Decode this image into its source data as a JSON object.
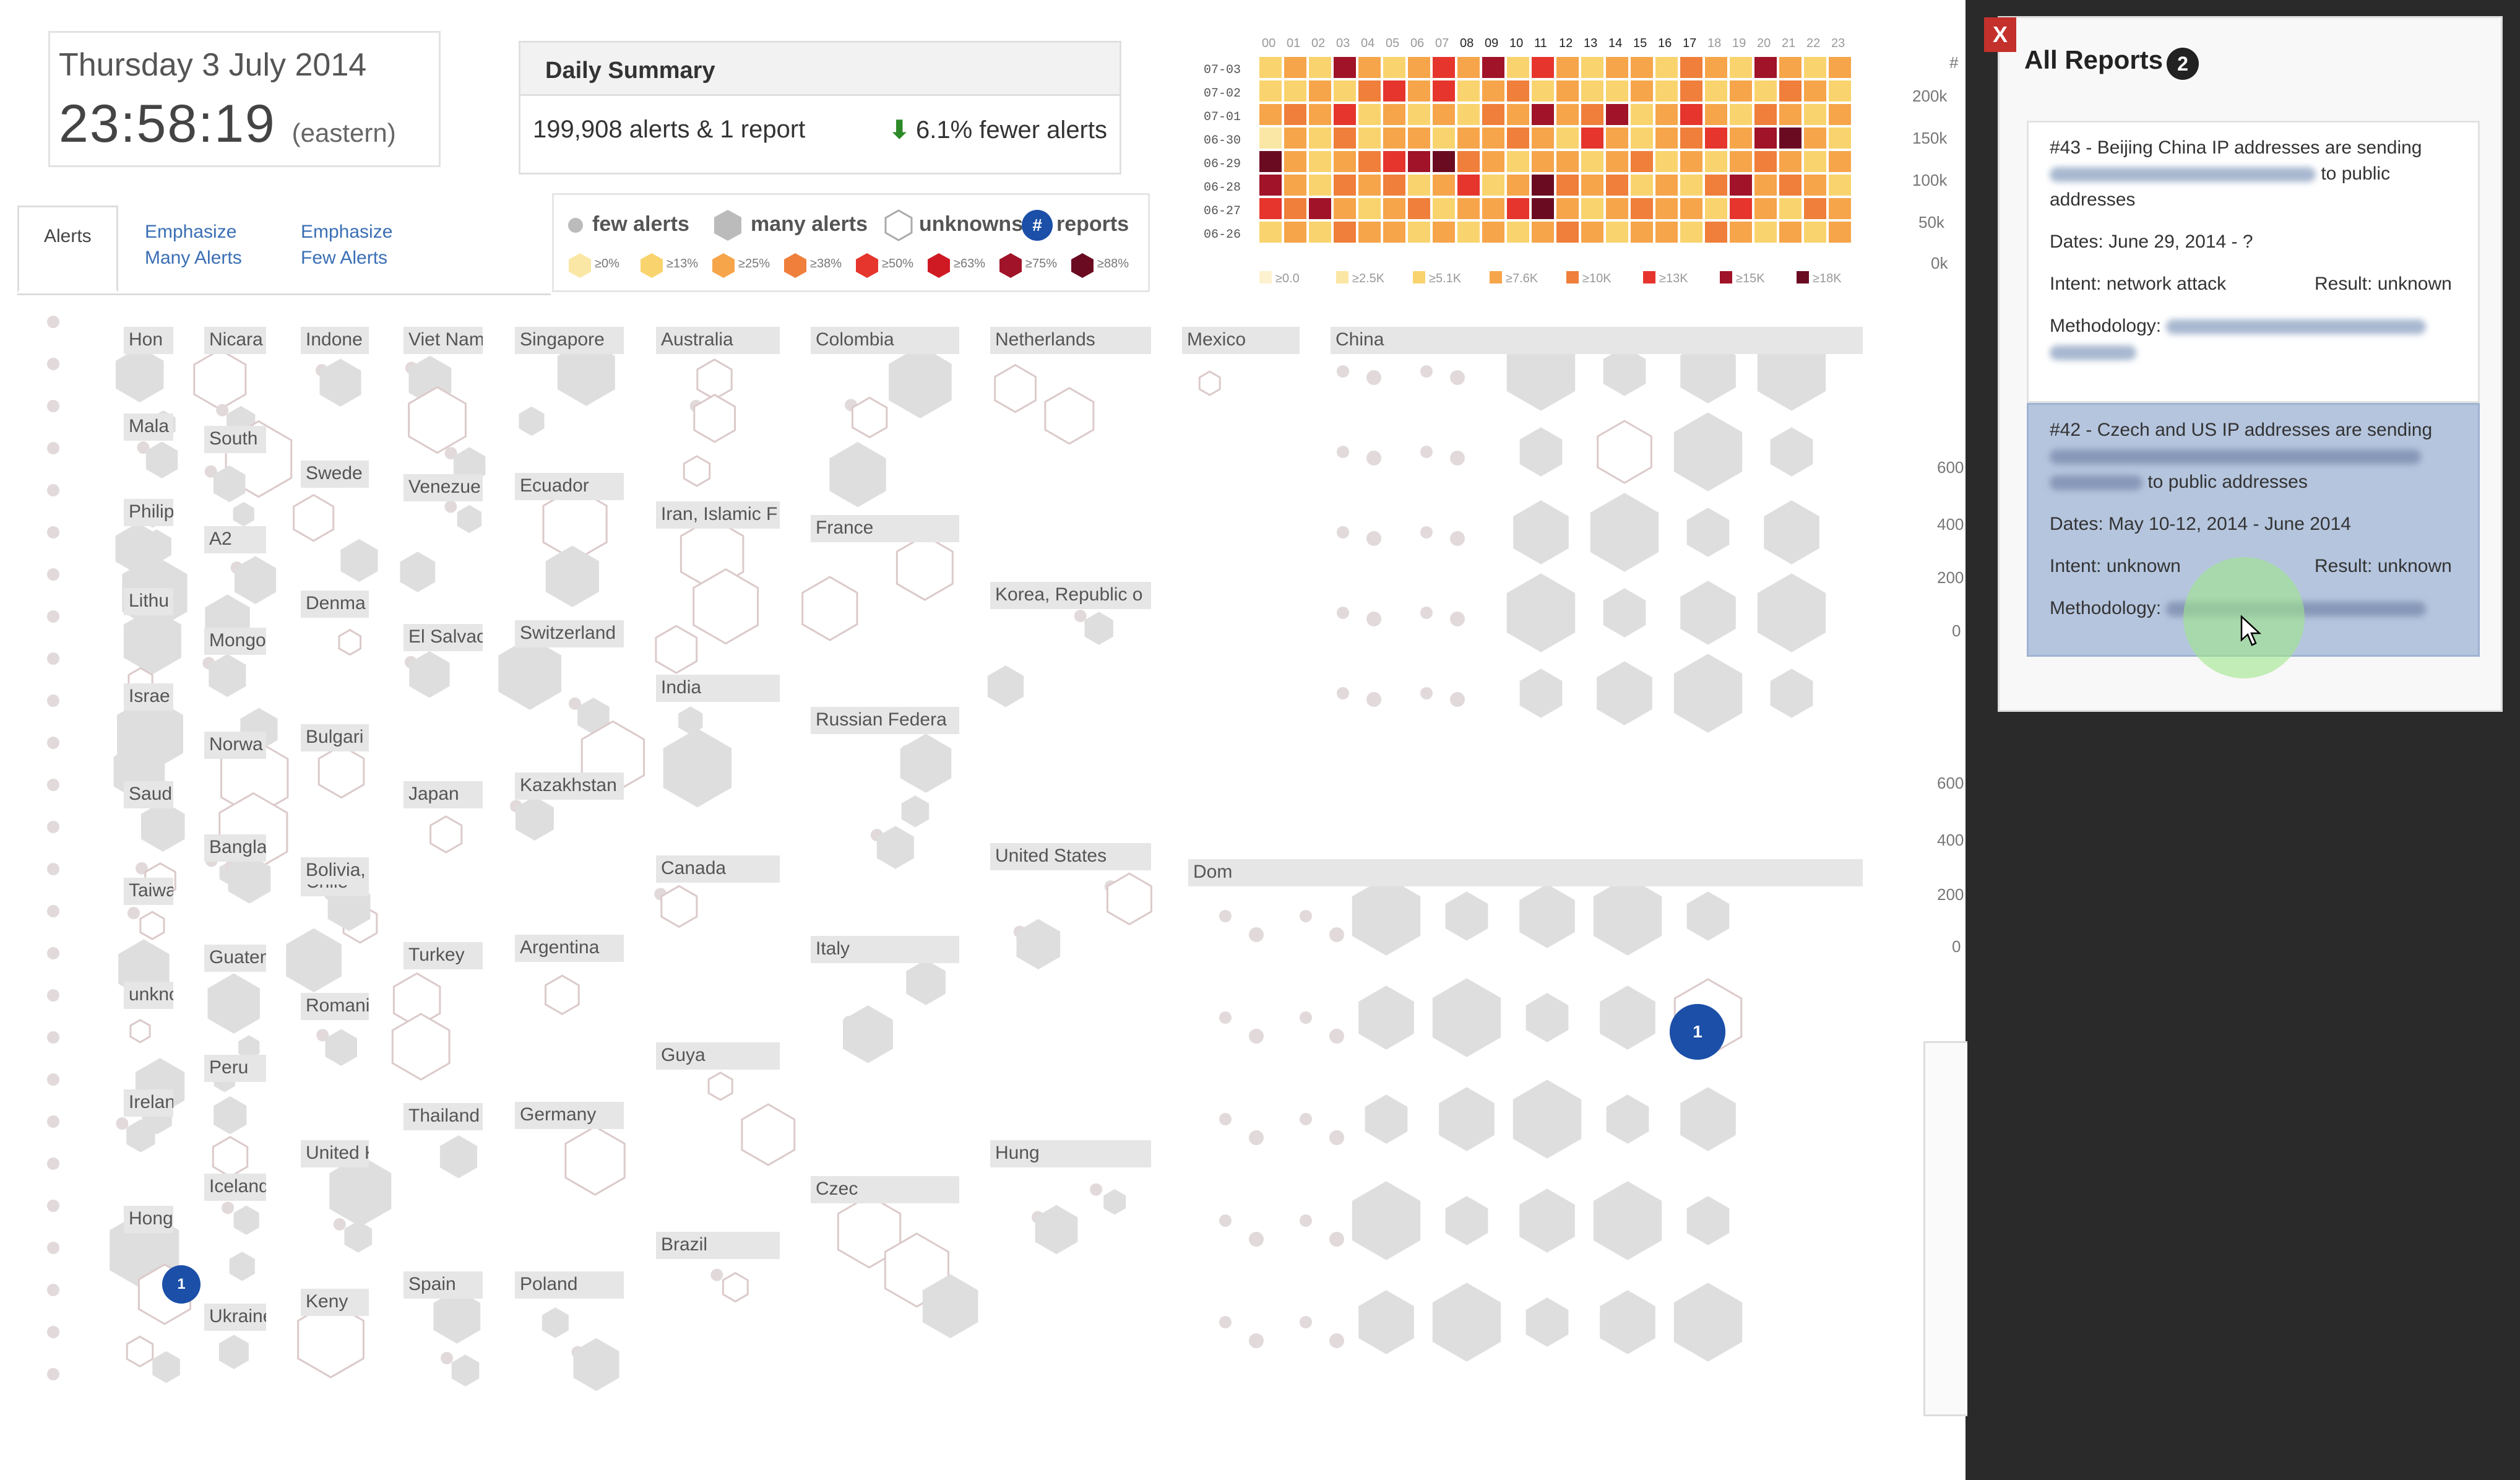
{
  "clock": {
    "date": "Thursday 3 July 2014",
    "time": "23:58:19",
    "zone": "(eastern)"
  },
  "summary": {
    "title": "Daily Summary",
    "alerts_text": "199,908 alerts & 1 report",
    "change_text": "6.1% fewer alerts",
    "change_arrow": "down-arrow-icon",
    "change_color": "#2d8a28"
  },
  "tabs": {
    "alerts": "Alerts",
    "emph_many_1": "Emphasize",
    "emph_many_2": "Many Alerts",
    "emph_few_1": "Emphasize",
    "emph_few_2": "Few Alerts"
  },
  "legend": {
    "few": "few alerts",
    "many": "many alerts",
    "unknowns": "unknowns",
    "reports": "reports",
    "report_symbol": "#",
    "swatches": [
      {
        "label": "≥0%",
        "color": "#fbe7a5"
      },
      {
        "label": "≥13%",
        "color": "#f9d46e"
      },
      {
        "label": "≥25%",
        "color": "#f6a54a"
      },
      {
        "label": "≥38%",
        "color": "#ef7f3a"
      },
      {
        "label": "≥50%",
        "color": "#e5352d"
      },
      {
        "label": "≥63%",
        "color": "#cf1a24"
      },
      {
        "label": "≥75%",
        "color": "#a01328"
      },
      {
        "label": "≥88%",
        "color": "#6b0b22"
      }
    ]
  },
  "heatmap": {
    "hours": [
      "00",
      "01",
      "02",
      "03",
      "04",
      "05",
      "06",
      "07",
      "08",
      "09",
      "10",
      "11",
      "12",
      "13",
      "14",
      "15",
      "16",
      "17",
      "18",
      "19",
      "20",
      "21",
      "22",
      "23"
    ],
    "days": [
      "07-03",
      "07-02",
      "07-01",
      "06-30",
      "06-29",
      "06-28",
      "06-27",
      "06-26"
    ],
    "cells": [
      [
        2,
        3,
        2,
        6,
        3,
        2,
        3,
        5,
        3,
        6,
        2,
        5,
        3,
        2,
        3,
        3,
        2,
        4,
        3,
        2,
        6,
        3,
        2,
        3
      ],
      [
        2,
        2,
        3,
        2,
        4,
        5,
        3,
        5,
        2,
        3,
        4,
        2,
        3,
        2,
        2,
        3,
        2,
        4,
        2,
        3,
        2,
        4,
        3,
        2
      ],
      [
        3,
        4,
        3,
        5,
        2,
        3,
        2,
        3,
        2,
        4,
        3,
        6,
        3,
        4,
        6,
        2,
        3,
        5,
        3,
        2,
        4,
        3,
        2,
        3
      ],
      [
        1,
        3,
        2,
        4,
        2,
        3,
        3,
        2,
        3,
        3,
        4,
        3,
        2,
        5,
        3,
        2,
        3,
        4,
        5,
        3,
        6,
        7,
        3,
        2
      ],
      [
        7,
        3,
        2,
        3,
        4,
        5,
        6,
        7,
        4,
        3,
        2,
        3,
        3,
        2,
        3,
        4,
        2,
        3,
        2,
        3,
        4,
        3,
        2,
        3
      ],
      [
        6,
        3,
        2,
        4,
        3,
        4,
        2,
        3,
        5,
        2,
        3,
        7,
        4,
        3,
        4,
        2,
        3,
        2,
        4,
        6,
        3,
        4,
        3,
        2
      ],
      [
        5,
        4,
        6,
        3,
        2,
        3,
        4,
        2,
        3,
        3,
        5,
        7,
        3,
        2,
        3,
        4,
        3,
        3,
        2,
        5,
        3,
        2,
        4,
        3
      ],
      [
        2,
        3,
        2,
        4,
        3,
        3,
        2,
        3,
        2,
        3,
        2,
        3,
        4,
        3,
        2,
        3,
        3,
        2,
        4,
        3,
        2,
        3,
        2,
        3
      ]
    ],
    "palette": [
      "#fdf2cf",
      "#fbe7a5",
      "#f9d46e",
      "#f6a54a",
      "#ef7f3a",
      "#e5352d",
      "#a01328",
      "#6b0b22"
    ],
    "bottom_labels": [
      "≥0.0",
      "≥2.5K",
      "≥5.1K",
      "≥7.6K",
      "≥10K",
      "≥13K",
      "≥15K",
      "≥18K"
    ]
  },
  "axis": {
    "hash": "#",
    "ticks": [
      "200k",
      "150k",
      "100k",
      "50k",
      "0k"
    ],
    "mid_ticks": [
      "600",
      "400",
      "200",
      "0"
    ],
    "low_ticks": [
      "600",
      "400",
      "200",
      "0"
    ]
  },
  "countries": [
    "Hon",
    "Nicara",
    "Indone",
    "Viet Nam",
    "Singapore",
    "Australia",
    "Colombia",
    "Netherlands",
    "Mexico",
    "China",
    "Mala",
    "South",
    "Swede",
    "Venezue",
    "Ecuador",
    "Iran, Islamic F",
    "France",
    "Korea, Republic o",
    "Philip",
    "A2",
    "Denma",
    "El Salvac",
    "Switzerland",
    "India",
    "Russian Federa",
    "Lithu",
    "Mongo",
    "Bulgari",
    "Israe",
    "Norwa",
    "Chile",
    "Japan",
    "Kazakhstan",
    "Canada",
    "United States",
    "Dom",
    "Saudi",
    "Bangla",
    "Bolivia, F",
    "Turkey",
    "Argentina",
    "Italy",
    "Taiwan",
    "Guatem",
    "Romania",
    "Guya",
    "unknov",
    "Peru",
    "Thailand",
    "Germany",
    "Hung",
    "Ireland",
    "Iceland",
    "United Kingdo",
    "Brazil",
    "Czec",
    "Hong Ko",
    "Spain",
    "Poland",
    "Ukraine",
    "Keny"
  ],
  "markers": {
    "us_report": "1",
    "czech_report": "1"
  },
  "popup": {
    "title": "All Reports",
    "count": "2",
    "close": "X",
    "r1": {
      "line1": "#43 - Beijing China IP addresses are sending",
      "line2_tail": "to public",
      "line3": "addresses",
      "dates": "Dates: June 29, 2014 - ?",
      "intent": "Intent: network attack",
      "result": "Result: unknown",
      "method": "Methodology:"
    },
    "r2": {
      "line1": "#42 - Czech and US IP addresses are sending",
      "line2_tail": "to public addresses",
      "dates": "Dates: May 10-12, 2014 - June 2014",
      "intent": "Intent: unknown",
      "result": "Result: unknown",
      "method": "Methodology:"
    }
  }
}
